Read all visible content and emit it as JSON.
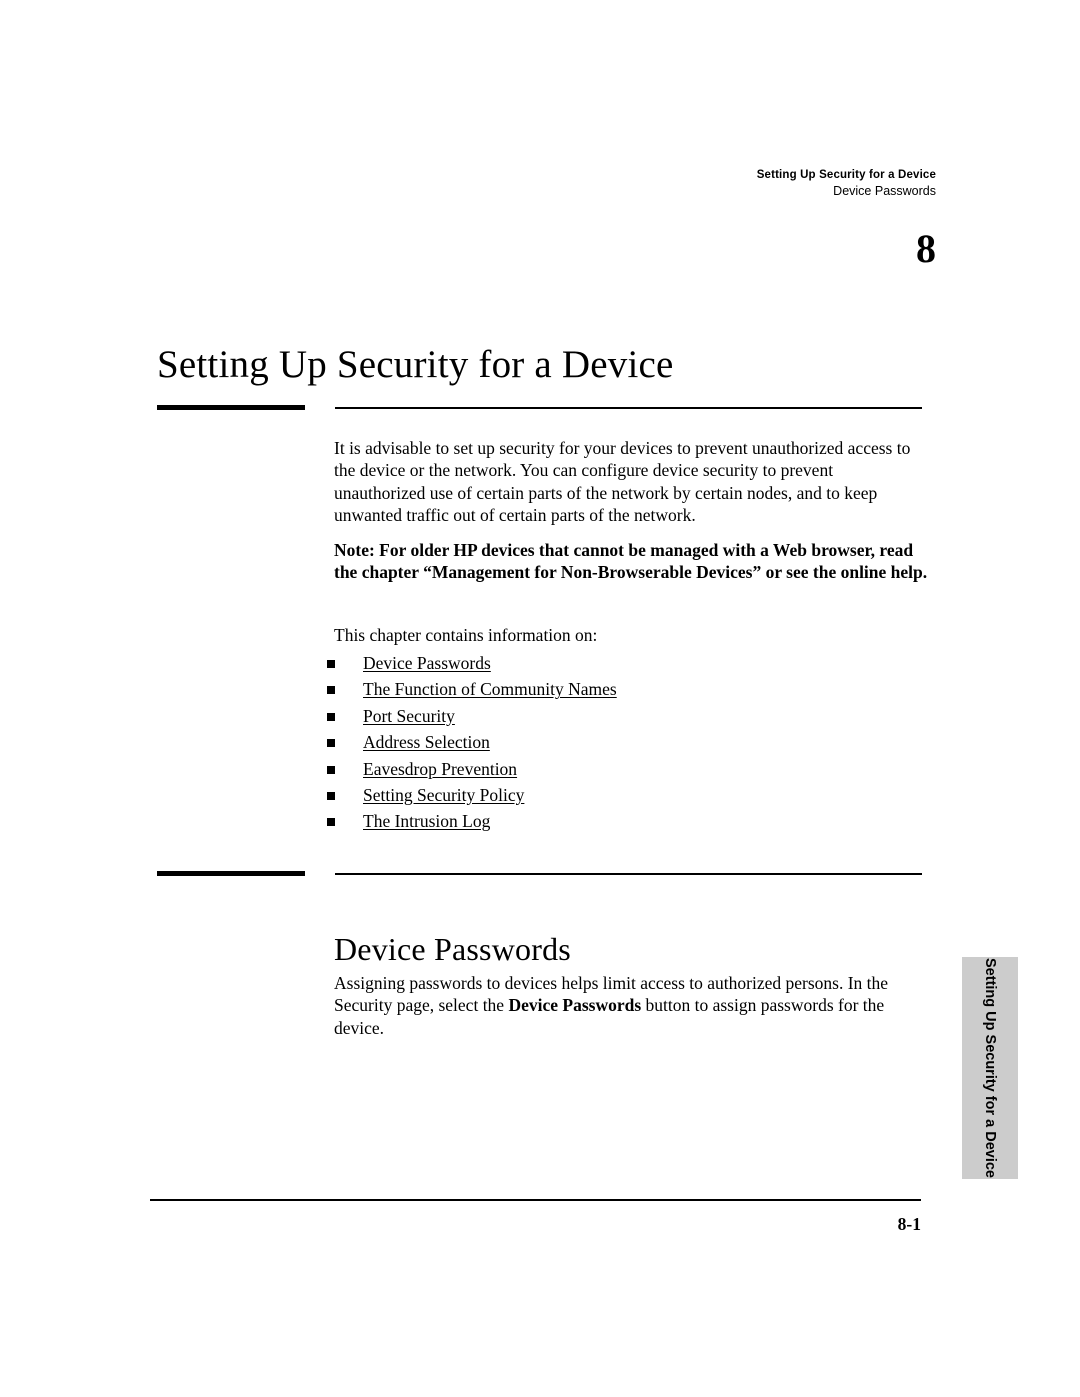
{
  "running_header": {
    "chapter_title": "Setting Up Security for a Device",
    "section_title": "Device Passwords"
  },
  "chapter": {
    "number": "8",
    "title": "Setting Up Security for a Device"
  },
  "intro": {
    "paragraph": "It is advisable to set up security for your devices to prevent unauthorized access to the device or the network. You can configure device security to prevent unauthorized use of certain parts of the network by certain nodes, and to keep unwanted traffic out of certain parts of the network.",
    "note": "Note: For older HP devices that cannot be managed with a Web browser, read the chapter “Management for Non-Browserable Devices” or see the online help.",
    "contains_line": "This chapter contains information on:"
  },
  "toc_links": [
    {
      "label": "Device Passwords"
    },
    {
      "label": "The Function of Community Names"
    },
    {
      "label": "Port Security"
    },
    {
      "label": "Address Selection"
    },
    {
      "label": "Eavesdrop Prevention"
    },
    {
      "label": "Setting Security Policy"
    },
    {
      "label": "The Intrusion Log"
    }
  ],
  "section": {
    "heading": "Device Passwords",
    "paragraph_part1": "Assigning passwords to devices helps limit access to authorized persons. In the Security page, select the ",
    "paragraph_bold": "Device Passwords",
    "paragraph_part2": " button to assign passwords for the device."
  },
  "side_tab": {
    "label": "Setting Up Security for a Device",
    "background_color": "#cccccc"
  },
  "footer": {
    "page_number": "8-1"
  }
}
